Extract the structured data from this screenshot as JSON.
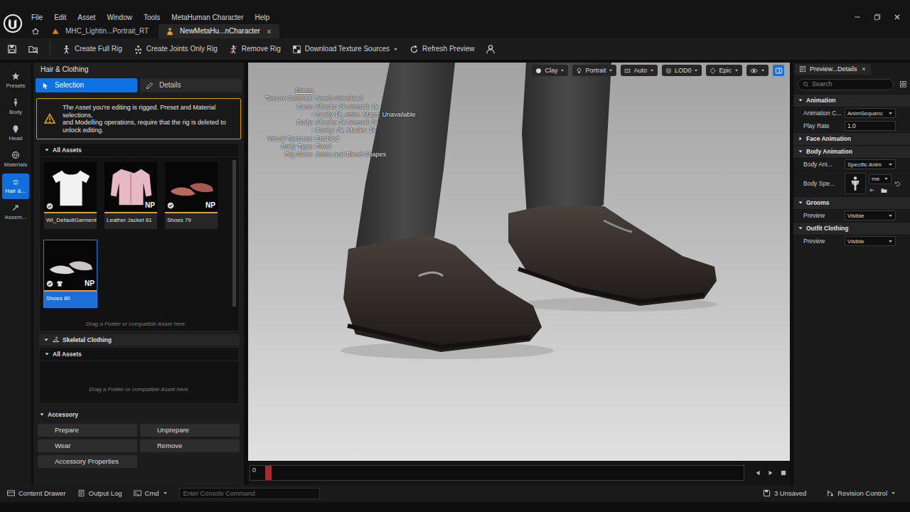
{
  "window": {
    "menu": [
      "File",
      "Edit",
      "Asset",
      "Window",
      "Tools",
      "MetaHuman Character",
      "Help"
    ],
    "doc_tabs": [
      {
        "label": "MHC_Lightin...Portrait_RT",
        "selected": false
      },
      {
        "label": "NewMetaHu...nCharacter",
        "selected": true
      }
    ]
  },
  "toolbar": {
    "buttons": [
      {
        "label": "Create Full Rig",
        "dropdown": false
      },
      {
        "label": "Create Joints Only Rig",
        "dropdown": false
      },
      {
        "label": "Remove Rig",
        "dropdown": false
      },
      {
        "label": "Download Texture Sources",
        "dropdown": true
      },
      {
        "label": "Refresh Preview",
        "dropdown": false
      }
    ]
  },
  "sidebar": {
    "items": [
      {
        "label": "Presets",
        "selected": false
      },
      {
        "label": "Body",
        "selected": false
      },
      {
        "label": "Head",
        "selected": false
      },
      {
        "label": "Materials",
        "selected": false
      },
      {
        "label": "Hair &...",
        "selected": true
      },
      {
        "label": "Assem...",
        "selected": false
      }
    ]
  },
  "left_panel": {
    "title": "Hair & Clothing",
    "tabs": [
      {
        "label": "Selection",
        "selected": true
      },
      {
        "label": "Details",
        "selected": false
      }
    ],
    "warning": [
      "The Asset you're editing is rigged. Preset and Material selections,",
      "and Modelling operations, require that the rig is deleted to unlock editing."
    ],
    "outfit": {
      "header": "All Assets",
      "expanded": true,
      "assets": [
        {
          "label": "WI_DefaultGarment",
          "installed": true,
          "wearable": false,
          "selected": false,
          "kind": "shirt"
        },
        {
          "label": "Leather Jacket 81",
          "installed": false,
          "wearable": false,
          "selected": false,
          "kind": "jacket",
          "badge": "NP"
        },
        {
          "label": "Shoes 79",
          "installed": true,
          "wearable": false,
          "selected": false,
          "kind": "shoes-red",
          "badge": "NP"
        },
        {
          "label": "Shoes 80",
          "installed": true,
          "wearable": true,
          "selected": true,
          "kind": "shoes-white",
          "badge": "NP"
        }
      ],
      "drop_hint": "Drag a Folder or compatible Asset here."
    },
    "skeletal": {
      "title": "Skeletal Clothing",
      "expanded": true,
      "header": "All Assets",
      "header_expanded": true,
      "drop_hint": "Drag a Folder or compatible Asset here."
    },
    "accessory": {
      "title": "Accessory",
      "expanded": true,
      "buttons": [
        "Prepare",
        "Unprepare",
        "Wear",
        "Remove",
        "Accessory Properties"
      ]
    }
  },
  "viewport": {
    "toolbar": [
      {
        "label": "Clay"
      },
      {
        "label": "Portrait"
      },
      {
        "label": "Auto"
      },
      {
        "label": "LOD0"
      },
      {
        "label": "Epic"
      }
    ],
    "layout_toggle": {
      "on": true
    },
    "status": {
      "title": "Status",
      "rows": [
        {
          "label": "Texture Sources:",
          "value": "Needs download"
        },
        {
          "label": "Face:",
          "value": "Albedo: 1k Normal: 1k"
        },
        {
          "label": ":",
          "value": "Cavity 1k, Anim. Maps: Unavailable"
        },
        {
          "label": "Body:",
          "value": "Albedo: 2k Normal: 2k"
        },
        {
          "label": ":",
          "value": "Cavity: 2k, Masks: 1k"
        },
        {
          "label": "Virtual Textures:",
          "value": "Enabled"
        },
        {
          "label": "Body Type:",
          "value": "Fixed"
        },
        {
          "label": "Rig State:",
          "value": "Joints and Blend Shapes"
        }
      ]
    },
    "timeline": {
      "frame": "0",
      "level": 0.03
    }
  },
  "details": {
    "tab": "Preview...Details",
    "search": {
      "placeholder": "Search"
    },
    "sections": [
      {
        "title": "Animation",
        "expanded": true,
        "rows": [
          {
            "label": "Animation C...",
            "kind": "dropdown",
            "value": "AnimSequenc"
          },
          {
            "label": "Play Rate",
            "kind": "input",
            "value": "1.0"
          }
        ]
      },
      {
        "title": "Face Animation",
        "expanded": false,
        "rows": []
      },
      {
        "title": "Body Animation",
        "expanded": true,
        "rows": [
          {
            "label": "Body Ani...",
            "kind": "dropdown",
            "value": "Specific Anim"
          },
          {
            "label": "Body Spe...",
            "kind": "asset",
            "value": "me"
          }
        ]
      },
      {
        "title": "Grooms",
        "expanded": true,
        "rows": [
          {
            "label": "Preview",
            "kind": "dropdown",
            "value": "Visible"
          }
        ]
      },
      {
        "title": "Outfit Clothing",
        "expanded": true,
        "rows": [
          {
            "label": "Preview",
            "kind": "dropdown",
            "value": "Visible"
          }
        ]
      }
    ]
  },
  "status_bar": {
    "items": [
      {
        "label": "Content Drawer",
        "dropdown": false
      },
      {
        "label": "Output Log",
        "dropdown": false
      },
      {
        "label": "Cmd",
        "dropdown": true
      }
    ],
    "console": {
      "placeholder": "Enter Console Command"
    },
    "unsaved": "3 Unsaved",
    "revision": {
      "label": "Revision Control",
      "dropdown": true
    }
  }
}
